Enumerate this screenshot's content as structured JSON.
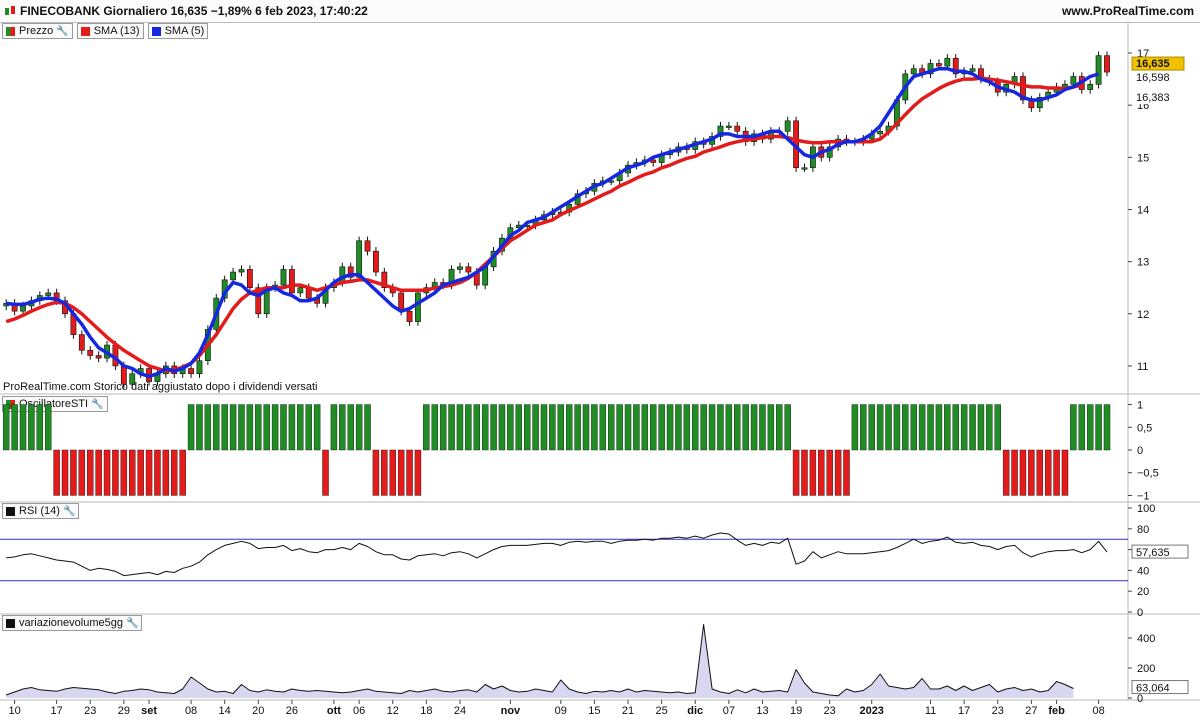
{
  "header": {
    "title": "FINECOBANK Giornaliero 16,635 −1,89% 6 feb 2023, 17:40:22",
    "site": "www.ProRealTime.com"
  },
  "note": "ProRealTime.com  Storico dati aggiustato dopo i dividendi versati",
  "legends": {
    "price": [
      {
        "label": "Prezzo",
        "color": "#1f8c24"
      },
      {
        "label": "SMA (13)",
        "color": "#e41b1b"
      },
      {
        "label": "SMA (5)",
        "color": "#1528e0"
      }
    ],
    "sti": {
      "label": "OscillatoreSTI"
    },
    "rsi": {
      "label": "RSI (14)"
    },
    "vol": {
      "label": "variazionevolume5gg"
    }
  },
  "colors": {
    "up": "#1f8c24",
    "down": "#e41b1b",
    "sma13": "#e41b1b",
    "sma5": "#1528e0",
    "last_price_bg": "#f2c200"
  },
  "x_axis": {
    "labels": [
      {
        "text": "10",
        "i": 1,
        "bold": false
      },
      {
        "text": "17",
        "i": 6,
        "bold": false
      },
      {
        "text": "23",
        "i": 10,
        "bold": false
      },
      {
        "text": "29",
        "i": 14,
        "bold": false
      },
      {
        "text": "set",
        "i": 17,
        "bold": true
      },
      {
        "text": "08",
        "i": 22,
        "bold": false
      },
      {
        "text": "14",
        "i": 26,
        "bold": false
      },
      {
        "text": "20",
        "i": 30,
        "bold": false
      },
      {
        "text": "26",
        "i": 34,
        "bold": false
      },
      {
        "text": "ott",
        "i": 39,
        "bold": true
      },
      {
        "text": "06",
        "i": 42,
        "bold": false
      },
      {
        "text": "12",
        "i": 46,
        "bold": false
      },
      {
        "text": "18",
        "i": 50,
        "bold": false
      },
      {
        "text": "24",
        "i": 54,
        "bold": false
      },
      {
        "text": "nov",
        "i": 60,
        "bold": true
      },
      {
        "text": "09",
        "i": 66,
        "bold": false
      },
      {
        "text": "15",
        "i": 70,
        "bold": false
      },
      {
        "text": "21",
        "i": 74,
        "bold": false
      },
      {
        "text": "25",
        "i": 78,
        "bold": false
      },
      {
        "text": "dic",
        "i": 82,
        "bold": true
      },
      {
        "text": "07",
        "i": 86,
        "bold": false
      },
      {
        "text": "13",
        "i": 90,
        "bold": false
      },
      {
        "text": "19",
        "i": 94,
        "bold": false
      },
      {
        "text": "23",
        "i": 98,
        "bold": false
      },
      {
        "text": "2023",
        "i": 103,
        "bold": true
      },
      {
        "text": "11",
        "i": 110,
        "bold": false
      },
      {
        "text": "17",
        "i": 114,
        "bold": false
      },
      {
        "text": "23",
        "i": 118,
        "bold": false
      },
      {
        "text": "27",
        "i": 122,
        "bold": false
      },
      {
        "text": "feb",
        "i": 125,
        "bold": true
      },
      {
        "text": "08",
        "i": 130,
        "bold": false
      }
    ]
  },
  "chart_data": [
    {
      "type": "candlestick",
      "name": "price",
      "ylim": [
        10.5,
        17.25
      ],
      "y_ticks": [
        11,
        12,
        13,
        14,
        15,
        16,
        17
      ],
      "closes": [
        12.2,
        12.05,
        12.15,
        12.25,
        12.35,
        12.4,
        12.25,
        12.0,
        11.6,
        11.3,
        11.2,
        11.15,
        11.4,
        11.0,
        10.65,
        10.85,
        10.95,
        10.7,
        10.85,
        11.0,
        10.85,
        10.95,
        10.85,
        11.1,
        11.7,
        12.3,
        12.65,
        12.8,
        12.85,
        12.5,
        12.0,
        12.5,
        12.55,
        12.85,
        12.4,
        12.5,
        12.3,
        12.2,
        12.5,
        12.6,
        12.9,
        12.7,
        13.4,
        13.2,
        12.8,
        12.5,
        12.4,
        12.05,
        11.85,
        12.4,
        12.5,
        12.6,
        12.55,
        12.85,
        12.9,
        12.8,
        12.55,
        12.9,
        13.2,
        13.45,
        13.65,
        13.7,
        13.7,
        13.8,
        13.9,
        13.95,
        13.95,
        14.1,
        14.3,
        14.35,
        14.5,
        14.55,
        14.55,
        14.7,
        14.85,
        14.9,
        14.95,
        14.9,
        15.05,
        15.1,
        15.2,
        15.15,
        15.3,
        15.25,
        15.4,
        15.6,
        15.6,
        15.5,
        15.3,
        15.45,
        15.35,
        15.5,
        15.5,
        15.7,
        14.8,
        14.8,
        15.2,
        15.0,
        15.2,
        15.35,
        15.3,
        15.3,
        15.35,
        15.45,
        15.5,
        15.6,
        16.1,
        16.6,
        16.7,
        16.6,
        16.8,
        16.75,
        16.9,
        16.6,
        16.65,
        16.7,
        16.5,
        16.45,
        16.25,
        16.4,
        16.55,
        16.1,
        15.95,
        16.15,
        16.25,
        16.35,
        16.4,
        16.55,
        16.3,
        16.4,
        16.95,
        16.635
      ],
      "sma5": [
        12.2,
        12.18,
        12.18,
        12.22,
        12.28,
        12.3,
        12.28,
        12.2,
        12.0,
        11.8,
        11.55,
        11.35,
        11.25,
        11.15,
        11.0,
        10.95,
        10.85,
        10.8,
        10.85,
        10.95,
        10.9,
        10.95,
        11.05,
        11.25,
        11.6,
        12.0,
        12.4,
        12.6,
        12.55,
        12.4,
        12.35,
        12.45,
        12.5,
        12.4,
        12.35,
        12.25,
        12.25,
        12.3,
        12.45,
        12.6,
        12.7,
        12.75,
        12.75,
        12.6,
        12.45,
        12.3,
        12.15,
        12.05,
        12.1,
        12.2,
        12.3,
        12.4,
        12.55,
        12.6,
        12.65,
        12.7,
        12.8,
        12.9,
        13.1,
        13.3,
        13.5,
        13.6,
        13.75,
        13.8,
        13.85,
        13.95,
        14.05,
        14.15,
        14.25,
        14.35,
        14.45,
        14.5,
        14.6,
        14.7,
        14.8,
        14.85,
        14.9,
        15.0,
        15.05,
        15.1,
        15.15,
        15.2,
        15.25,
        15.3,
        15.35,
        15.45,
        15.45,
        15.4,
        15.4,
        15.4,
        15.45,
        15.5,
        15.5,
        15.35,
        15.2,
        15.05,
        15.0,
        15.1,
        15.15,
        15.25,
        15.3,
        15.3,
        15.35,
        15.45,
        15.6,
        15.85,
        16.1,
        16.35,
        16.55,
        16.6,
        16.65,
        16.7,
        16.7,
        16.65,
        16.65,
        16.6,
        16.5,
        16.45,
        16.35,
        16.3,
        16.25,
        16.15,
        16.1,
        16.1,
        16.15,
        16.2,
        16.3,
        16.35,
        16.45,
        16.55,
        16.598
      ],
      "sma13": [
        11.85,
        11.9,
        11.97,
        12.05,
        12.12,
        12.18,
        12.22,
        12.2,
        12.12,
        12.0,
        11.85,
        11.7,
        11.55,
        11.42,
        11.3,
        11.2,
        11.1,
        11.0,
        10.95,
        10.9,
        10.92,
        10.98,
        11.05,
        11.2,
        11.4,
        11.6,
        11.85,
        12.1,
        12.28,
        12.4,
        12.45,
        12.5,
        12.5,
        12.5,
        12.55,
        12.55,
        12.5,
        12.45,
        12.5,
        12.55,
        12.6,
        12.62,
        12.65,
        12.65,
        12.6,
        12.55,
        12.5,
        12.45,
        12.45,
        12.45,
        12.45,
        12.5,
        12.52,
        12.55,
        12.6,
        12.68,
        12.8,
        12.95,
        13.1,
        13.25,
        13.4,
        13.5,
        13.6,
        13.7,
        13.75,
        13.8,
        13.9,
        13.98,
        14.05,
        14.12,
        14.2,
        14.28,
        14.35,
        14.45,
        14.52,
        14.6,
        14.67,
        14.72,
        14.8,
        14.85,
        14.92,
        14.98,
        15.02,
        15.1,
        15.15,
        15.2,
        15.26,
        15.3,
        15.33,
        15.35,
        15.38,
        15.4,
        15.4,
        15.38,
        15.33,
        15.3,
        15.28,
        15.28,
        15.3,
        15.3,
        15.3,
        15.3,
        15.3,
        15.3,
        15.35,
        15.48,
        15.65,
        15.82,
        15.98,
        16.12,
        16.22,
        16.32,
        16.4,
        16.46,
        16.5,
        16.5,
        16.52,
        16.5,
        16.48,
        16.45,
        16.42,
        16.38,
        16.35,
        16.35,
        16.33,
        16.33,
        16.32,
        16.35,
        16.383
      ],
      "last_labels": [
        {
          "text": "16,635",
          "value": 16.635,
          "bg": "#f2c200",
          "color": "#111111"
        },
        {
          "text": "16,598",
          "value": 16.598,
          "bg": "#ffffff",
          "color": "#1528e0"
        },
        {
          "text": "16,383",
          "value": 16.383,
          "bg": "#ffffff",
          "color": "#e41b1b"
        }
      ]
    },
    {
      "type": "bar",
      "name": "OscillatoreSTI",
      "ylim": [
        -1.1,
        1.1
      ],
      "y_ticks": [
        {
          "v": 1,
          "t": "1"
        },
        {
          "v": 0.5,
          "t": "0,5"
        },
        {
          "v": 0,
          "t": "0"
        },
        {
          "v": -0.5,
          "t": "−0,5"
        },
        {
          "v": -1,
          "t": "−1"
        }
      ],
      "values": [
        1,
        1,
        1,
        1,
        1,
        1,
        -1,
        -1,
        -1,
        -1,
        -1,
        -1,
        -1,
        -1,
        -1,
        -1,
        -1,
        -1,
        -1,
        -1,
        -1,
        -1,
        1,
        1,
        1,
        1,
        1,
        1,
        1,
        1,
        1,
        1,
        1,
        1,
        1,
        1,
        1,
        1,
        -1,
        1,
        1,
        1,
        1,
        1,
        -1,
        -1,
        -1,
        -1,
        -1,
        -1,
        1,
        1,
        1,
        1,
        1,
        1,
        1,
        1,
        1,
        1,
        1,
        1,
        1,
        1,
        1,
        1,
        1,
        1,
        1,
        1,
        1,
        1,
        1,
        1,
        1,
        1,
        1,
        1,
        1,
        1,
        1,
        1,
        1,
        1,
        1,
        1,
        1,
        1,
        1,
        1,
        1,
        1,
        1,
        1,
        -1,
        -1,
        -1,
        -1,
        -1,
        -1,
        -1,
        1,
        1,
        1,
        1,
        1,
        1,
        1,
        1,
        1,
        1,
        1,
        1,
        1,
        1,
        1,
        1,
        1,
        1,
        -1,
        -1,
        -1,
        -1,
        -1,
        -1,
        -1,
        -1,
        1,
        1,
        1,
        1,
        1
      ]
    },
    {
      "type": "line",
      "name": "RSI (14)",
      "ylim": [
        0,
        100
      ],
      "y_ticks": [
        0,
        20,
        40,
        60,
        80,
        100
      ],
      "levels": [
        70,
        30
      ],
      "last_label": "57,635",
      "values": [
        52,
        53,
        55,
        56,
        54,
        52,
        50,
        49,
        48,
        44,
        40,
        42,
        41,
        39,
        35,
        36,
        37,
        38,
        36,
        39,
        38,
        42,
        44,
        48,
        55,
        60,
        64,
        66,
        68,
        66,
        61,
        62,
        62,
        64,
        59,
        61,
        58,
        57,
        60,
        60,
        62,
        60,
        66,
        63,
        58,
        55,
        55,
        51,
        50,
        54,
        55,
        56,
        54,
        57,
        58,
        56,
        52,
        56,
        60,
        63,
        64,
        64,
        64,
        65,
        66,
        66,
        64,
        67,
        68,
        67,
        68,
        68,
        66,
        68,
        69,
        69,
        70,
        69,
        71,
        71,
        72,
        71,
        73,
        71,
        74,
        76,
        75,
        69,
        64,
        66,
        64,
        67,
        66,
        71,
        46,
        49,
        58,
        52,
        55,
        58,
        56,
        56,
        56,
        57,
        58,
        59,
        62,
        66,
        70,
        66,
        68,
        69,
        72,
        67,
        66,
        67,
        64,
        63,
        60,
        63,
        64,
        57,
        53,
        56,
        58,
        59,
        59,
        60,
        57,
        60,
        68,
        57.6
      ]
    },
    {
      "type": "area",
      "name": "variazionevolume5gg",
      "ylim": [
        0,
        520
      ],
      "y_ticks": [
        0,
        200,
        400
      ],
      "last_label": "63,064",
      "values": [
        20,
        40,
        60,
        70,
        55,
        50,
        45,
        60,
        70,
        65,
        60,
        55,
        40,
        30,
        45,
        50,
        60,
        55,
        40,
        35,
        30,
        60,
        140,
        100,
        60,
        40,
        45,
        30,
        90,
        50,
        40,
        55,
        45,
        40,
        60,
        50,
        45,
        50,
        45,
        40,
        35,
        40,
        50,
        60,
        45,
        40,
        35,
        30,
        50,
        40,
        50,
        60,
        45,
        40,
        50,
        55,
        40,
        90,
        60,
        80,
        50,
        40,
        45,
        60,
        50,
        40,
        120,
        60,
        40,
        30,
        45,
        40,
        50,
        40,
        60,
        40,
        50,
        45,
        40,
        35,
        40,
        30,
        35,
        490,
        60,
        40,
        30,
        55,
        35,
        60,
        40,
        45,
        50,
        40,
        190,
        100,
        40,
        30,
        20,
        15,
        60,
        40,
        50,
        90,
        160,
        80,
        70,
        60,
        70,
        130,
        60,
        60,
        80,
        50,
        80,
        50,
        70,
        90,
        40,
        60,
        70,
        50,
        60,
        40,
        50,
        110,
        90,
        63
      ]
    }
  ]
}
